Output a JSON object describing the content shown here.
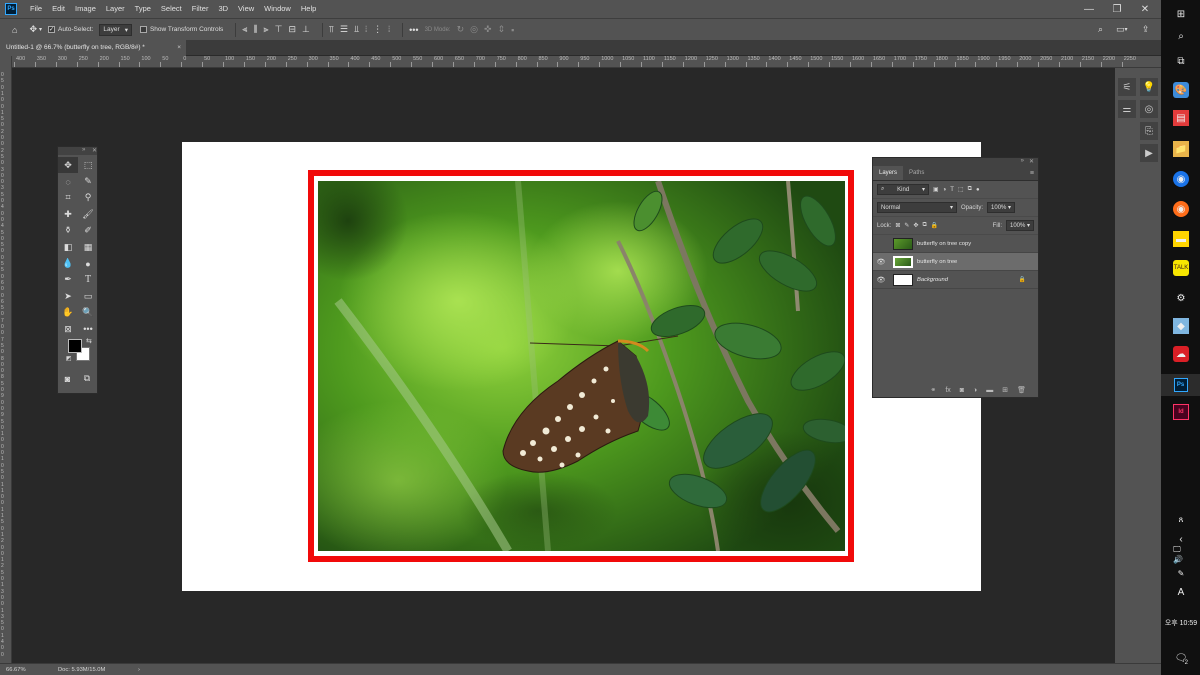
{
  "app": {
    "logo": "Ps",
    "menus": [
      "File",
      "Edit",
      "Image",
      "Layer",
      "Type",
      "Select",
      "Filter",
      "3D",
      "View",
      "Window",
      "Help"
    ]
  },
  "options": {
    "auto_select_label": "Auto-Select:",
    "auto_select_value": "Layer",
    "transform_label": "Show Transform Controls",
    "mode_label": "3D Mode:"
  },
  "document": {
    "tab_title": "Untitled-1 @ 66.7% (butterfly on tree, RGB/8#) *",
    "close": "×"
  },
  "ruler": {
    "h_labels": [
      "400",
      "350",
      "300",
      "250",
      "200",
      "150",
      "100",
      "50",
      "0",
      "50",
      "100",
      "150",
      "200",
      "250",
      "300",
      "350",
      "400",
      "450",
      "500",
      "550",
      "600",
      "650",
      "700",
      "750",
      "800",
      "850",
      "900",
      "950",
      "1000",
      "1050",
      "1100",
      "1150",
      "1200",
      "1250",
      "1300",
      "1350",
      "1400",
      "1450",
      "1500",
      "1550",
      "1600",
      "1650",
      "1700",
      "1750",
      "1800",
      "1850",
      "1900",
      "1950",
      "2000",
      "2050",
      "2100",
      "2150",
      "2200",
      "2250"
    ],
    "v_labels": [
      "0",
      "5",
      "0",
      "1",
      "0",
      "0",
      "1",
      "5",
      "0",
      "2",
      "0",
      "0",
      "2",
      "5",
      "0",
      "3",
      "0",
      "0",
      "3",
      "5",
      "0",
      "4",
      "0",
      "0",
      "4",
      "5",
      "0",
      "5",
      "0",
      "0",
      "5",
      "5",
      "0",
      "6",
      "0",
      "0",
      "6",
      "5",
      "0",
      "7",
      "0",
      "0",
      "7",
      "5",
      "0",
      "8",
      "0",
      "0",
      "8",
      "5",
      "0",
      "9",
      "0",
      "0",
      "9",
      "5",
      "0",
      "1",
      "0",
      "0",
      "0",
      "1",
      "0",
      "5",
      "0",
      "1",
      "1",
      "0",
      "0",
      "1",
      "1",
      "5",
      "0",
      "1",
      "2",
      "0",
      "0",
      "1",
      "2",
      "5",
      "0",
      "1",
      "3",
      "0",
      "0",
      "1",
      "3",
      "5",
      "0",
      "1",
      "4",
      "0",
      "0"
    ]
  },
  "layers_panel": {
    "tabs": [
      "Layers",
      "Paths"
    ],
    "kind_label": "Kind",
    "blend_mode": "Normal",
    "opacity_label": "Opacity:",
    "opacity_value": "100%",
    "lock_label": "Lock:",
    "fill_label": "Fill:",
    "fill_value": "100%",
    "layers": [
      {
        "name": "butterfly on tree copy",
        "visible": false,
        "selected": false
      },
      {
        "name": "butterfly on tree",
        "visible": true,
        "selected": true
      },
      {
        "name": "Background",
        "visible": true,
        "selected": false,
        "locked": true
      }
    ]
  },
  "status": {
    "zoom": "66.67%",
    "doc": "Doc: 5.93M/15.0M"
  },
  "taskbar": {
    "time_period": "오후",
    "time": "10:59",
    "notif_count": "2",
    "lang": "A"
  },
  "colors": {
    "frame_red": "#f10a0a",
    "ps_blue": "#31a8ff"
  }
}
